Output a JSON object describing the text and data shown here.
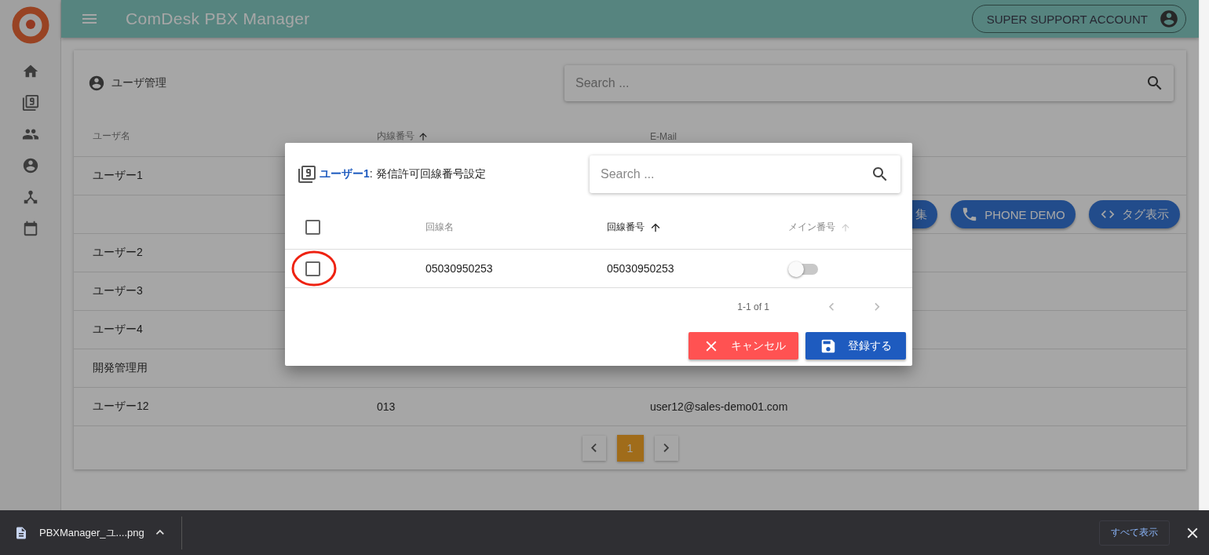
{
  "app": {
    "title": "ComDesk PBX Manager",
    "account": "SUPER SUPPORT ACCOUNT"
  },
  "page": {
    "title": "ユーザ管理",
    "search": {
      "placeholder": "Search ..."
    }
  },
  "table": {
    "columns": [
      {
        "label": "ユーザ名",
        "sorted": false
      },
      {
        "label": "内線番号",
        "sorted": true
      },
      {
        "label": "E-Mail",
        "sorted": false
      }
    ],
    "rows": [
      {
        "kind": "user",
        "cells": [
          "ユーザー1"
        ]
      },
      {
        "kind": "actions",
        "buttons": [
          {
            "label": "集",
            "kind": "plain"
          },
          {
            "label": "PHONE DEMO",
            "kind": "phone"
          },
          {
            "label": "タグ表示",
            "kind": "code"
          }
        ]
      },
      {
        "kind": "user",
        "cells": [
          "ユーザー2"
        ]
      },
      {
        "kind": "user",
        "cells": [
          "ユーザー3"
        ]
      },
      {
        "kind": "user",
        "cells": [
          "ユーザー4"
        ]
      },
      {
        "kind": "user",
        "cells": [
          "開発管理用"
        ]
      },
      {
        "kind": "user",
        "cells": [
          "ユーザー12",
          "013",
          "user12@sales-demo01.com"
        ]
      }
    ]
  },
  "pagination": {
    "pages": [
      {
        "label": "1",
        "selected": true
      }
    ]
  },
  "dialog": {
    "title": "**ユーザー1**: 発信許可回線番号設定",
    "search": {
      "placeholder": "Search ..."
    },
    "select_all": {
      "checked": false
    },
    "columns": [
      {
        "label": "回線名",
        "sortable": false,
        "sorted": false
      },
      {
        "label": "回線番号",
        "sortable": true,
        "sorted": true
      },
      {
        "label": "メイン番号",
        "sortable": true,
        "sorted": false
      }
    ],
    "rows": [
      {
        "checked": false,
        "circled": true,
        "cells": [
          "05030950253",
          "05030950253"
        ],
        "main": {
          "on": false
        }
      }
    ],
    "range": "1-1 of 1",
    "buttons": [
      {
        "label": "キャンセル",
        "kind": "cancel"
      },
      {
        "label": "登録する",
        "kind": "save"
      }
    ]
  },
  "download_bar": {
    "file": "PBXManager_ユ....png",
    "show_all": "すべて表示"
  }
}
